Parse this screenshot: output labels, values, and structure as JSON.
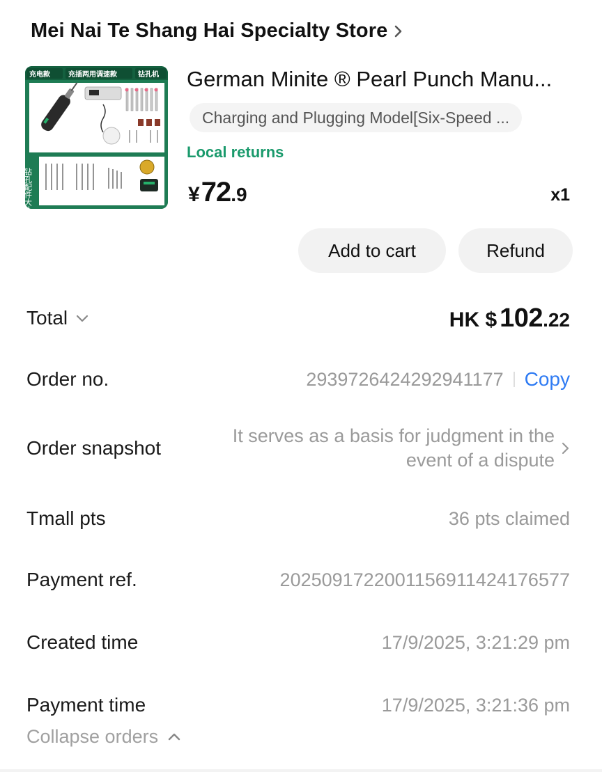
{
  "store": {
    "name": "Mei Nai Te Shang Hai Specialty Store"
  },
  "product": {
    "image_icon": "product-thumbnail",
    "title": "German Minite ® Pearl Punch Manu...",
    "sku": "Charging and Plugging Model[Six-Speed ...",
    "local_returns": "Local returns",
    "price_currency": "¥",
    "price_integer": "72",
    "price_decimal": ".9",
    "quantity": "x1",
    "image_text": {
      "tag1": "充电款",
      "tag2": "充插两用调速款",
      "tag3": "钻孔机",
      "side": "钻孔配件大礼包"
    }
  },
  "actions": {
    "add_to_cart": "Add to cart",
    "refund": "Refund"
  },
  "total": {
    "label": "Total",
    "currency": "HK $",
    "integer": "102",
    "decimal": ".22"
  },
  "order": {
    "label": "Order no.",
    "value": "2939726424292941177",
    "copy": "Copy"
  },
  "snapshot": {
    "label": "Order snapshot",
    "value": "It serves as a basis for judgment in the event of a dispute"
  },
  "points": {
    "label": "Tmall pts",
    "value": "36 pts claimed"
  },
  "payment_ref": {
    "label": "Payment ref.",
    "value": "2025091722001156911424176577"
  },
  "created": {
    "label": "Created time",
    "value": "17/9/2025, 3:21:29 pm"
  },
  "payment_time": {
    "label": "Payment time",
    "value": "17/9/2025, 3:21:36 pm"
  },
  "collapse": {
    "label": "Collapse orders"
  },
  "colors": {
    "accent_green": "#1a9a6c",
    "link_blue": "#2f7bf3",
    "muted_text": "#9a9a9a"
  }
}
